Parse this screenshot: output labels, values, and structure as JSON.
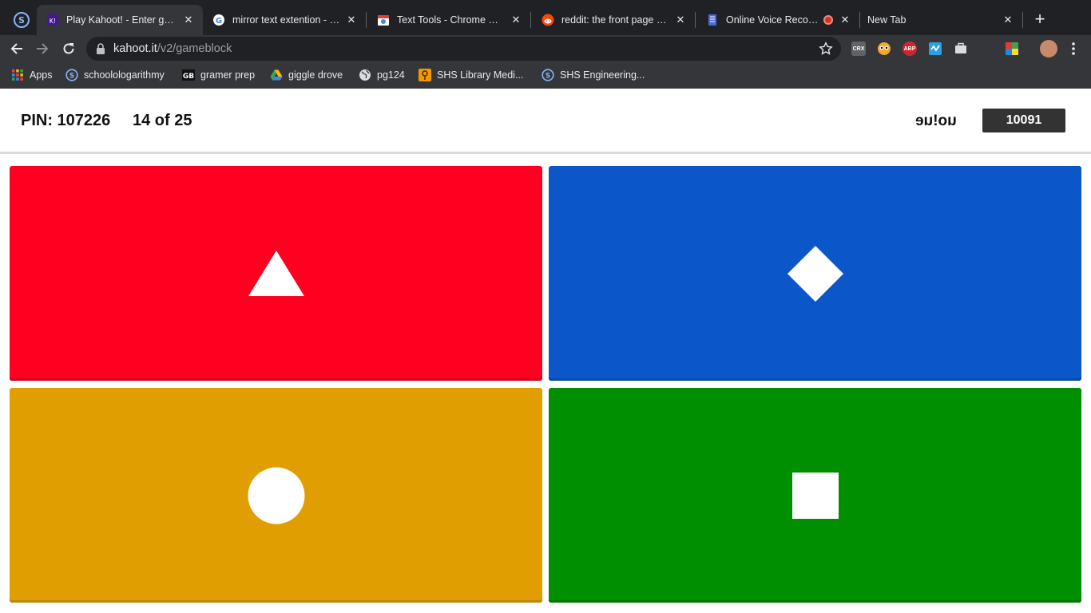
{
  "browser": {
    "tabs": [
      {
        "title": "Play Kahoot! - Enter game PIN",
        "active": true,
        "icon": "kahoot-icon"
      },
      {
        "title": "mirror text extention - Google Search",
        "active": false,
        "icon": "google-icon"
      },
      {
        "title": "Text Tools - Chrome Web Store",
        "active": false,
        "icon": "chrome-web-store-icon"
      },
      {
        "title": "reddit: the front page of the internet",
        "active": false,
        "icon": "reddit-icon"
      },
      {
        "title": "Online Voice Recorder",
        "active": false,
        "icon": "voice-recorder-icon",
        "recording": true
      },
      {
        "title": "New Tab",
        "active": false,
        "icon": ""
      }
    ],
    "url_host": "kahoot.it",
    "url_path": "/v2/gameblock",
    "extensions": [
      {
        "name": "crx-extension-icon",
        "label": "CRX"
      },
      {
        "name": "eyes-extension-icon",
        "label": ""
      },
      {
        "name": "adblock-plus-icon",
        "label": "ABP"
      },
      {
        "name": "blue-extension-icon",
        "label": ""
      },
      {
        "name": "briefcase-extension-icon",
        "label": ""
      },
      {
        "name": "color-extension-icon",
        "label": ""
      }
    ],
    "bookmarks": [
      {
        "label": "Apps",
        "icon": "apps-grid-icon"
      },
      {
        "label": "schoolologarithmy",
        "icon": "schoology-icon"
      },
      {
        "label": "gramer prep",
        "icon": "gb-icon"
      },
      {
        "label": "giggle drove",
        "icon": "google-drive-icon"
      },
      {
        "label": "pg124",
        "icon": "globe-icon"
      },
      {
        "label": "SHS Library Medi...",
        "icon": "library-icon"
      },
      {
        "label": "SHS Engineering...",
        "icon": "schoology-icon"
      }
    ]
  },
  "game": {
    "pin_text": "PIN: 107226",
    "question_counter": "14 of 25",
    "nickname": "uo!ue",
    "score": "10091",
    "answers": [
      {
        "shape": "triangle-icon",
        "color": "#ff0020"
      },
      {
        "shape": "diamond-icon",
        "color": "#0b57c9"
      },
      {
        "shape": "circle-icon",
        "color": "#e19e00"
      },
      {
        "shape": "square-icon",
        "color": "#008f00"
      }
    ]
  }
}
